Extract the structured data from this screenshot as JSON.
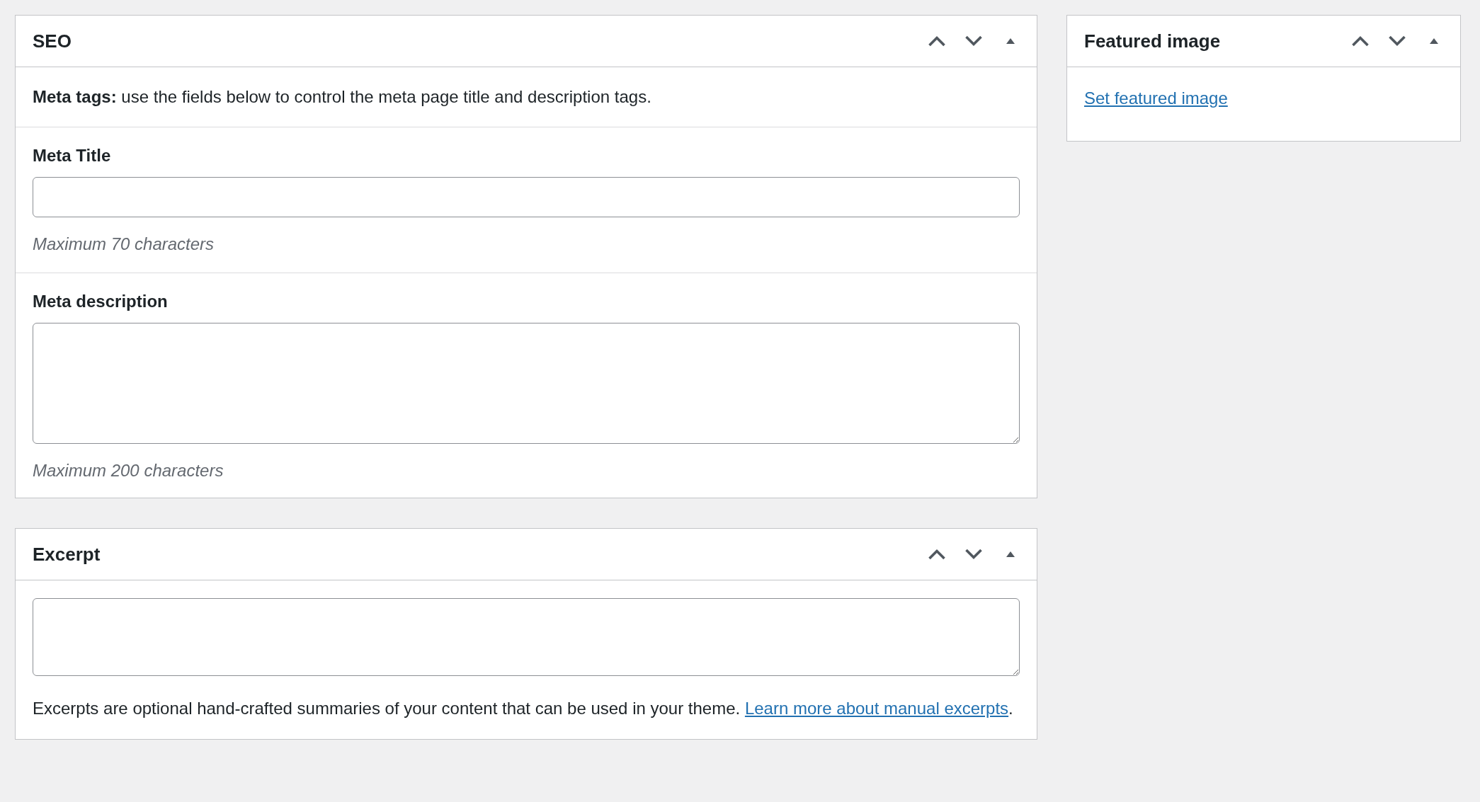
{
  "seo": {
    "title": "SEO",
    "expanded": true,
    "intro": "**Meta tags:** use the fields below to control the meta page title and description tags.",
    "fields": [
      {
        "kind": "input",
        "label": "Meta Title",
        "hint": "Maximum 70 characters"
      },
      {
        "kind": "textarea",
        "label": "Meta description",
        "hint": "Maximum 200 characters"
      }
    ]
  },
  "excerpt": {
    "title": "Excerpt",
    "expanded": true,
    "help": "Excerpts are optional hand-crafted summaries of your content that can be used in your theme.",
    "link": "Learn more about manual excerpts",
    "after": "."
  },
  "featured": {
    "title": "Featured image",
    "expanded": true,
    "link": "Set featured image"
  }
}
